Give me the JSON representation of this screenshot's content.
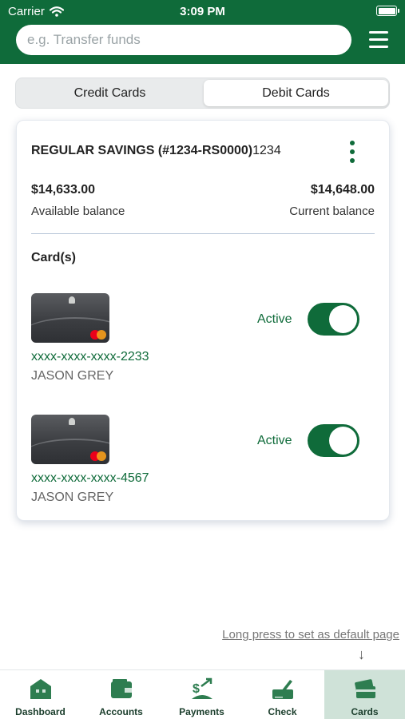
{
  "status_bar": {
    "carrier": "Carrier",
    "time": "3:09 PM"
  },
  "search": {
    "placeholder": "e.g. Transfer funds"
  },
  "segments": {
    "credit": "Credit Cards",
    "debit": "Debit Cards",
    "selected": "Debit Cards"
  },
  "account": {
    "name": "REGULAR SAVINGS (#1234-RS0000)",
    "suffix": "1234",
    "available_amount": "$14,633.00",
    "available_label": "Available balance",
    "current_amount": "$14,648.00",
    "current_label": "Current balance",
    "cards_label": "Card(s)"
  },
  "cards": [
    {
      "number": "xxxx-xxxx-xxxx-2233",
      "holder": "JASON GREY",
      "status": "Active",
      "enabled": true
    },
    {
      "number": "xxxx-xxxx-xxxx-4567",
      "holder": "JASON GREY",
      "status": "Active",
      "enabled": true
    }
  ],
  "hint": "Long press to set as default page",
  "tabs": [
    {
      "label": "Dashboard",
      "icon": "house-icon"
    },
    {
      "label": "Accounts",
      "icon": "wallet-icon"
    },
    {
      "label": "Payments",
      "icon": "payments-icon"
    },
    {
      "label": "Check",
      "icon": "check-deposit-icon"
    },
    {
      "label": "Cards",
      "icon": "card-icon",
      "active": true
    }
  ],
  "colors": {
    "brand": "#0f6b3a",
    "tab_active_bg": "#cfe2d8",
    "icon_green": "#2e7d50"
  }
}
